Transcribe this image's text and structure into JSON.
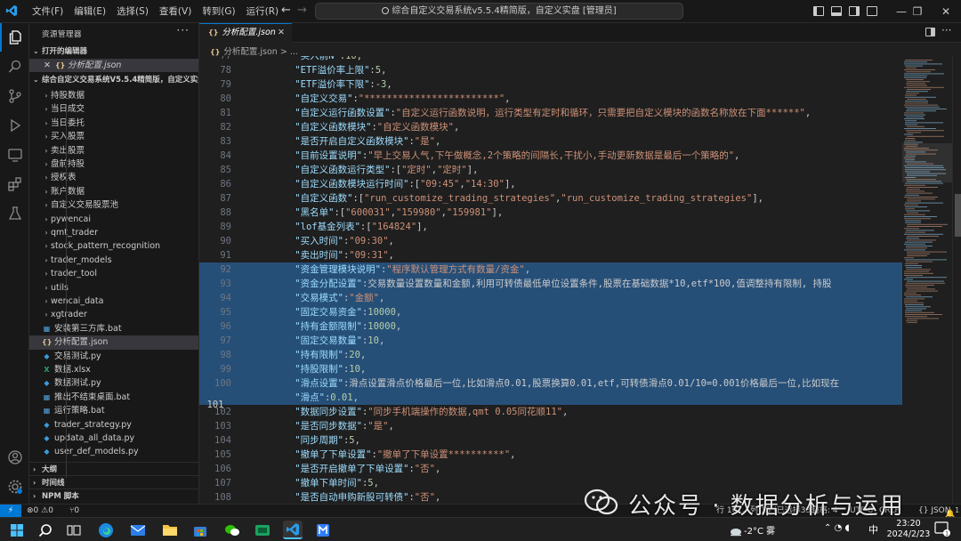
{
  "menu": [
    "文件(F)",
    "编辑(E)",
    "选择(S)",
    "查看(V)",
    "转到(G)",
    "运行(R)"
  ],
  "window_title": "综合自定义交易系统v5.5.4精简版，自定义实盘 [管理员]",
  "explorer": {
    "title": "资源管理器",
    "open_editors_label": "打开的编辑器",
    "open_editor_file": "分析配置.json",
    "workspace_label": "综合自定义交易系统V5.5.4精简版，自定义实盘...",
    "items": [
      {
        "label": "持股数据",
        "type": "folder"
      },
      {
        "label": "当日成交",
        "type": "folder"
      },
      {
        "label": "当日委托",
        "type": "folder"
      },
      {
        "label": "买入股票",
        "type": "folder"
      },
      {
        "label": "卖出股票",
        "type": "folder"
      },
      {
        "label": "盘前持股",
        "type": "folder"
      },
      {
        "label": "授权表",
        "type": "folder"
      },
      {
        "label": "账户数据",
        "type": "folder"
      },
      {
        "label": "自定义交易股票池",
        "type": "folder"
      },
      {
        "label": "pywencai",
        "type": "folder"
      },
      {
        "label": "qmt_trader",
        "type": "folder"
      },
      {
        "label": "stock_pattern_recognition",
        "type": "folder"
      },
      {
        "label": "trader_models",
        "type": "folder"
      },
      {
        "label": "trader_tool",
        "type": "folder"
      },
      {
        "label": "utils",
        "type": "folder"
      },
      {
        "label": "wencai_data",
        "type": "folder"
      },
      {
        "label": "xgtrader",
        "type": "folder"
      },
      {
        "label": "安装第三方库.bat",
        "type": "bat"
      },
      {
        "label": "分析配置.json",
        "type": "json",
        "selected": true
      },
      {
        "label": "交易测试.py",
        "type": "py"
      },
      {
        "label": "数据.xlsx",
        "type": "xlsx"
      },
      {
        "label": "数据测试.py",
        "type": "py"
      },
      {
        "label": "推出不结束桌面.bat",
        "type": "bat"
      },
      {
        "label": "运行策略.bat",
        "type": "bat"
      },
      {
        "label": "trader_strategy.py",
        "type": "py"
      },
      {
        "label": "updata_all_data.py",
        "type": "py"
      },
      {
        "label": "user_def_models.py",
        "type": "py"
      }
    ],
    "outline_label": "大纲",
    "timeline_label": "时间线",
    "npm_label": "NPM 脚本"
  },
  "editor": {
    "tab_label": "分析配置.json",
    "breadcrumb": "分析配置.json > ...",
    "current_line": 101,
    "lines": [
      {
        "n": 77,
        "t": "    \"买入前N\":10,",
        "partial": true
      },
      {
        "n": 78,
        "t": "    \"ETF溢价率上限\":5,"
      },
      {
        "n": 79,
        "t": "    \"ETF溢价率下限\":-3,"
      },
      {
        "n": 80,
        "t": "    \"自定义交易\":\"************************\","
      },
      {
        "n": 81,
        "t": "    \"自定义运行函数设置\":\"自定义运行函数说明，运行类型有定时和循环，只需要把自定义模块的函数名称放在下面******\","
      },
      {
        "n": 82,
        "t": "    \"自定义函数模块\":\"自定义函数模块\","
      },
      {
        "n": 83,
        "t": "    \"是否开启自定义函数模块\":\"是\","
      },
      {
        "n": 84,
        "t": "    \"目前设置说明\":\"早上交易人气,下午做概念,2个策略的间隔长,干扰小,手动更新数据是最后一个策略的\","
      },
      {
        "n": 85,
        "t": "    \"自定义函数运行类型\":[\"定时\",\"定时\"],"
      },
      {
        "n": 86,
        "t": "    \"自定义函数模块运行时间\":[\"09:45\",\"14:30\"],"
      },
      {
        "n": 87,
        "t": "    \"自定义函数\":[\"run_customize_trading_strategies\",\"run_customize_trading_strategies\"],"
      },
      {
        "n": 88,
        "t": "    \"黑名单\":[\"600031\",\"159980\",\"159981\"],"
      },
      {
        "n": 89,
        "t": "    \"lof基金列表\":[\"164824\"],"
      },
      {
        "n": 90,
        "t": "    \"买入时间\":\"09:30\","
      },
      {
        "n": 91,
        "t": "    \"卖出时间\":\"09:31\","
      },
      {
        "n": 92,
        "t": "    \"资金管理模块说明\":\"程序默认管理方式有数量/资金\",",
        "sel": true
      },
      {
        "n": 93,
        "t": "    \"资金分配设置\":\"交易数量设置数量和金额,利用可转债最低单位设置条件,股票在基础数据*10,etf*100,值调整持有限制, 持股",
        "sel": true
      },
      {
        "n": 94,
        "t": "    \"交易模式\":\"金额\",",
        "sel": true
      },
      {
        "n": 95,
        "t": "    \"固定交易资金\":10000,",
        "sel": true
      },
      {
        "n": 96,
        "t": "    \"持有金额限制\":10000,",
        "sel": true
      },
      {
        "n": 97,
        "t": "    \"固定交易数量\":10,",
        "sel": true
      },
      {
        "n": 98,
        "t": "    \"持有限制\":20,",
        "sel": true
      },
      {
        "n": 99,
        "t": "    \"持股限制\":10,",
        "sel": true
      },
      {
        "n": 100,
        "t": "    \"滑点设置\":\"滑点设置滑点价格最后一位,比如滑点0.01,股票换算0.01,etf,可转债滑点0.01/10=0.001价格最后一位,比如现在",
        "sel": true
      },
      {
        "n": 101,
        "t": "    \"滑点\":0.01,",
        "sel": true
      },
      {
        "n": 102,
        "t": "    \"数据同步设置\":\"同步手机端操作的数据,qmt 0.05同花顺11\","
      },
      {
        "n": 103,
        "t": "    \"是否同步数据\":\"是\","
      },
      {
        "n": 104,
        "t": "    \"同步周期\":5,"
      },
      {
        "n": 105,
        "t": "    \"撤单了下单设置\":\"撤单了下单设置**********\","
      },
      {
        "n": 106,
        "t": "    \"是否开启撤单了下单设置\":\"否\","
      },
      {
        "n": 107,
        "t": "    \"撤单下单时间\":5,"
      },
      {
        "n": 108,
        "t": "    \"是否自动申购新股可转债\":\"否\",",
        "partial": true
      }
    ]
  },
  "statusbar": {
    "remote": "⚡",
    "errors": "⊗0 ⚠0",
    "ports": "⑂0",
    "position": "行 101，列 15 (已选择331)",
    "spaces": "空格: 4",
    "encoding": "UTF-8",
    "eol": "CRLF",
    "language": "{} JSON",
    "notifications": "1"
  },
  "taskbar": {
    "weather": "-2°C 雾",
    "ime": "中",
    "time": "23:20",
    "date": "2024/2/23",
    "notify_count": "1"
  },
  "watermark": "公众号 · 数据分析与运用",
  "colors": {
    "accent": "#0078d4",
    "selection": "#264f78",
    "key": "#9cdcfe",
    "string": "#ce9178",
    "number": "#b5cea8"
  }
}
